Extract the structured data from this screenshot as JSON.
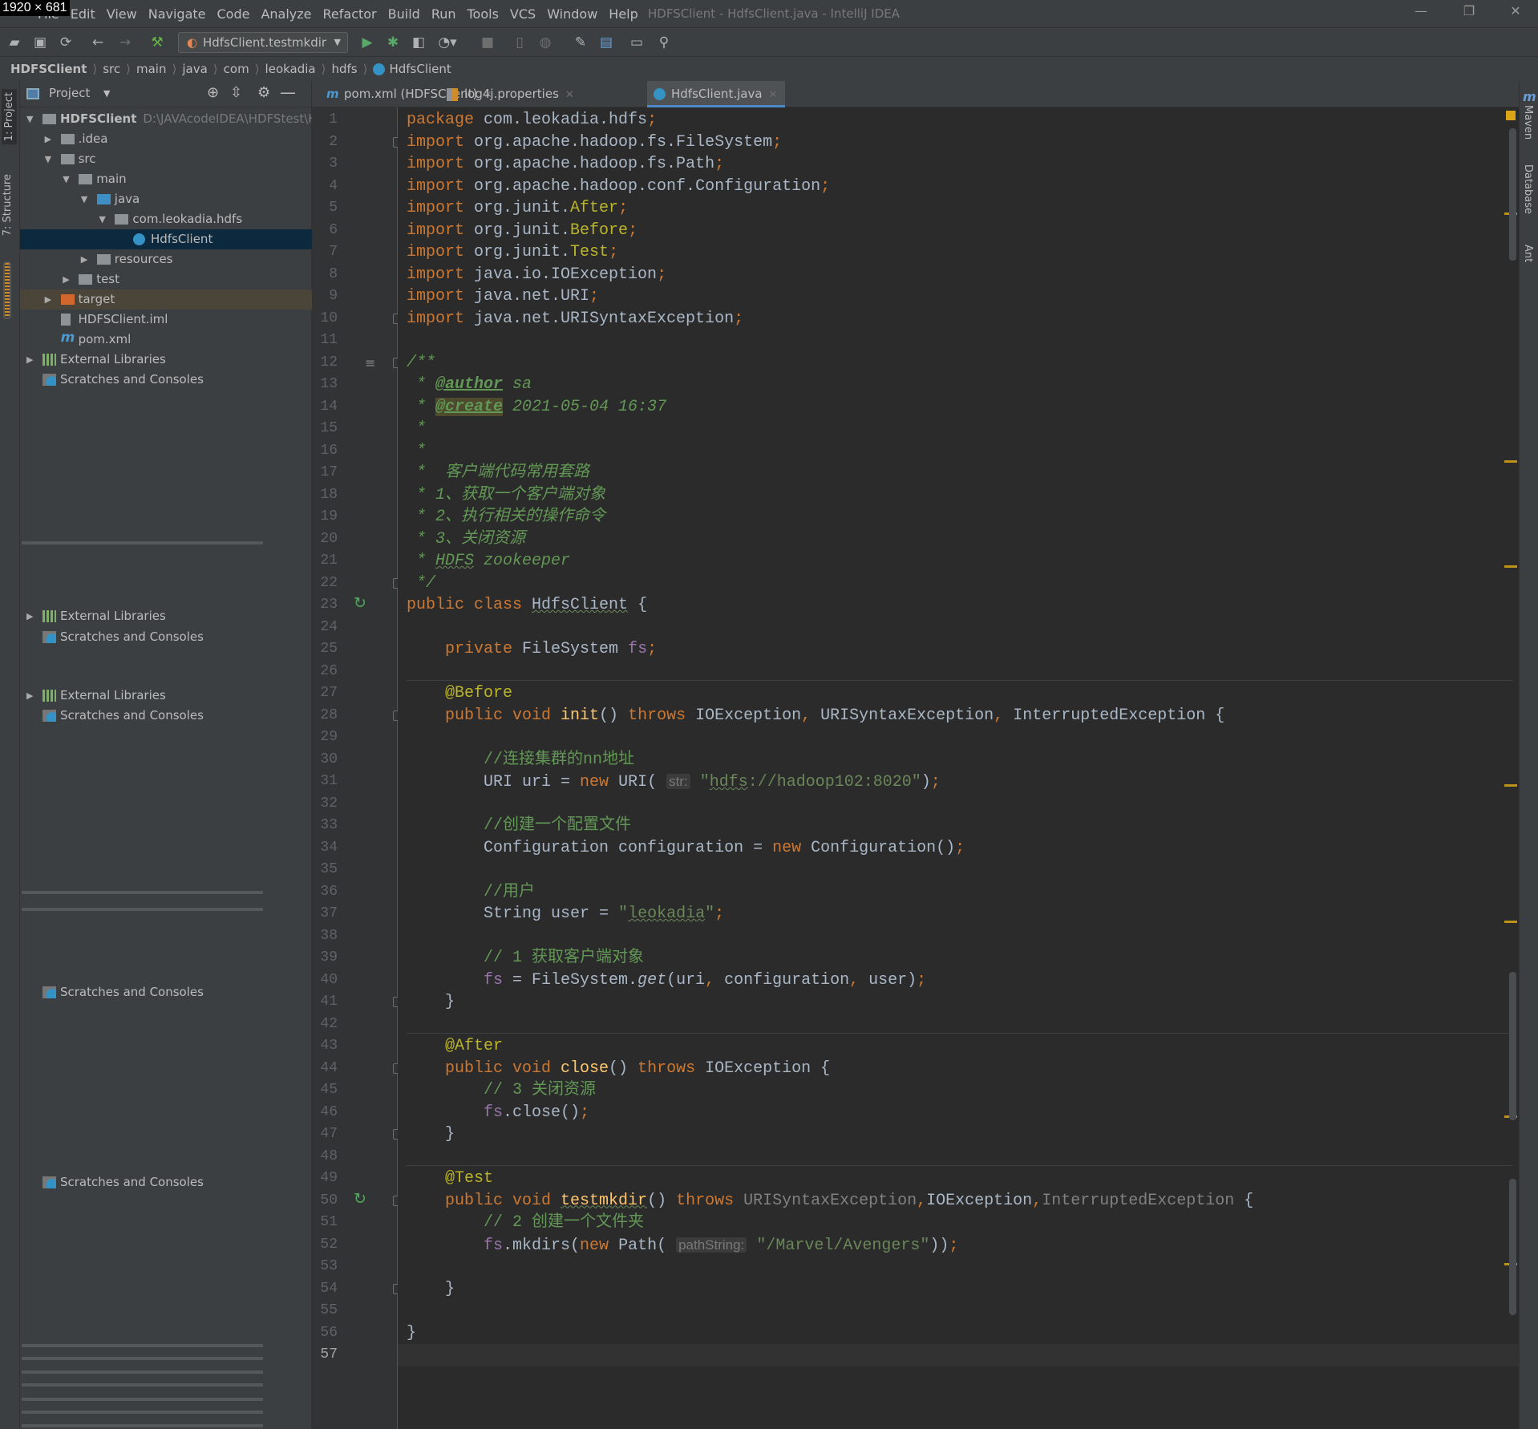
{
  "overlay_label": "1920 × 681",
  "window": {
    "title": "HDFSClient - HdfsClient.java - IntelliJ IDEA",
    "minimize": "—",
    "restore": "❐",
    "close": "✕"
  },
  "menu": [
    "File",
    "Edit",
    "View",
    "Navigate",
    "Code",
    "Analyze",
    "Refactor",
    "Build",
    "Run",
    "Tools",
    "VCS",
    "Window",
    "Help"
  ],
  "toolbar": {
    "run_config": "HdfsClient.testmkdir"
  },
  "breadcrumb": [
    "HDFSClient",
    "src",
    "main",
    "java",
    "com",
    "leokadia",
    "hdfs",
    "HdfsClient"
  ],
  "left_strip": {
    "project": "1: Project",
    "structure": "7: Structure"
  },
  "right_strip": {
    "maven": "Maven",
    "database": "Database",
    "ant": "Ant"
  },
  "project_panel": {
    "title": "Project",
    "tree": [
      {
        "level": 0,
        "state": "open",
        "icon": "module-folder-icon",
        "label": "HDFSClient",
        "hint": "D:\\JAVAcodeIDEA\\HDFStest\\HI",
        "bold": true
      },
      {
        "level": 1,
        "state": "closed",
        "icon": "folder-icon",
        "label": ".idea"
      },
      {
        "level": 1,
        "state": "open",
        "icon": "folder-icon",
        "label": "src"
      },
      {
        "level": 2,
        "state": "open",
        "icon": "folder-icon",
        "label": "main"
      },
      {
        "level": 3,
        "state": "open",
        "icon": "source-folder-icon",
        "label": "java"
      },
      {
        "level": 4,
        "state": "open",
        "icon": "package-icon",
        "label": "com.leokadia.hdfs"
      },
      {
        "level": 5,
        "state": "none",
        "icon": "java-class-icon",
        "label": "HdfsClient",
        "selected": true
      },
      {
        "level": 3,
        "state": "closed",
        "icon": "resources-folder-icon",
        "label": "resources"
      },
      {
        "level": 2,
        "state": "closed",
        "icon": "folder-icon",
        "label": "test"
      },
      {
        "level": 1,
        "state": "closed",
        "icon": "excluded-folder-icon",
        "label": "target",
        "highlight": true
      },
      {
        "level": 1,
        "state": "none",
        "icon": "iml-file-icon",
        "label": "HDFSClient.iml"
      },
      {
        "level": 1,
        "state": "none",
        "icon": "maven-icon",
        "label": "pom.xml"
      },
      {
        "level": 0,
        "state": "closed",
        "icon": "libraries-icon",
        "label": "External Libraries"
      },
      {
        "level": 0,
        "state": "none",
        "icon": "scratches-icon",
        "label": "Scratches and Consoles"
      }
    ],
    "ghost_rows": [
      {
        "label": "External Libraries",
        "arrow": true
      },
      {
        "label": "Scratches and Consoles"
      },
      {
        "label": "External Libraries",
        "arrow": true
      },
      {
        "label": "Scratches and Consoles"
      },
      {
        "label": "Scratches and Consoles"
      },
      {
        "label": "Scratches and Consoles"
      }
    ]
  },
  "tabs": [
    {
      "label": "pom.xml (HDFSClient)",
      "icon": "maven-icon",
      "active": false
    },
    {
      "label": "log4j.properties",
      "icon": "properties-file-icon",
      "active": false
    },
    {
      "label": "HdfsClient.java",
      "icon": "java-class-icon",
      "active": true
    }
  ],
  "editor": {
    "current_line": 57,
    "lines": [
      [
        [
          "package",
          "k"
        ],
        [
          " com.leokadia.hdfs",
          ""
        ],
        [
          ";",
          "k"
        ]
      ],
      [
        [
          "import",
          "k"
        ],
        [
          " org.apache.hadoop.fs.FileSystem",
          ""
        ],
        [
          ";",
          "k"
        ]
      ],
      [
        [
          "import",
          "k"
        ],
        [
          " org.apache.hadoop.fs.Path",
          ""
        ],
        [
          ";",
          "k"
        ]
      ],
      [
        [
          "import",
          "k"
        ],
        [
          " org.apache.hadoop.conf.Configuration",
          ""
        ],
        [
          ";",
          "k"
        ]
      ],
      [
        [
          "import",
          "k"
        ],
        [
          " org.junit.",
          ""
        ],
        [
          "After",
          "a"
        ],
        [
          ";",
          "k"
        ]
      ],
      [
        [
          "import",
          "k"
        ],
        [
          " org.junit.",
          ""
        ],
        [
          "Before",
          "a"
        ],
        [
          ";",
          "k"
        ]
      ],
      [
        [
          "import",
          "k"
        ],
        [
          " org.junit.",
          ""
        ],
        [
          "Test",
          "a"
        ],
        [
          ";",
          "k"
        ]
      ],
      [
        [
          "import",
          "k"
        ],
        [
          " java.io.IOException",
          ""
        ],
        [
          ";",
          "k"
        ]
      ],
      [
        [
          "import",
          "k"
        ],
        [
          " java.net.URI",
          ""
        ],
        [
          ";",
          "k"
        ]
      ],
      [
        [
          "import",
          "k"
        ],
        [
          " java.net.URISyntaxException",
          ""
        ],
        [
          ";",
          "k"
        ]
      ],
      [],
      [
        [
          "/**",
          "d"
        ]
      ],
      [
        [
          " * ",
          "d"
        ],
        [
          "@author",
          "dt"
        ],
        [
          " sa",
          "d"
        ]
      ],
      [
        [
          " * ",
          "d"
        ],
        [
          "@create",
          "dt dh"
        ],
        [
          " 2021-05-04 16:37",
          "d"
        ]
      ],
      [
        [
          " *",
          "d"
        ]
      ],
      [
        [
          " *",
          "d"
        ]
      ],
      [
        [
          " *  客户端代码常用套路",
          "d"
        ]
      ],
      [
        [
          " * 1、获取一个客户端对象",
          "d"
        ]
      ],
      [
        [
          " * 2、执行相关的操作命令",
          "d"
        ]
      ],
      [
        [
          " * 3、关闭资源",
          "d"
        ]
      ],
      [
        [
          " * ",
          "d"
        ],
        [
          "HDFS",
          "d u"
        ],
        [
          " zookeeper",
          "d"
        ]
      ],
      [
        [
          " */",
          "d"
        ]
      ],
      [
        [
          "public class ",
          "k"
        ],
        [
          "HdfsClient",
          "u"
        ],
        [
          " {",
          ""
        ]
      ],
      [],
      [
        [
          "    private ",
          "k"
        ],
        [
          "FileSystem ",
          ""
        ],
        [
          "fs",
          "f"
        ],
        [
          ";",
          "k"
        ]
      ],
      [],
      [
        [
          "    @Before",
          "a"
        ]
      ],
      [
        [
          "    public void ",
          "k"
        ],
        [
          "init",
          "m"
        ],
        [
          "() ",
          ""
        ],
        [
          "throws ",
          "k"
        ],
        [
          "IOException",
          ""
        ],
        [
          ", ",
          "k"
        ],
        [
          "URISyntaxException",
          ""
        ],
        [
          ", ",
          "k"
        ],
        [
          "InterruptedException {",
          ""
        ]
      ],
      [],
      [
        [
          "        //连接集群的nn地址",
          "c"
        ]
      ],
      [
        [
          "        URI uri = ",
          ""
        ],
        [
          "new ",
          "k"
        ],
        [
          "URI( ",
          ""
        ],
        [
          "str:",
          "h"
        ],
        [
          " ",
          ""
        ],
        [
          "\"",
          "s"
        ],
        [
          "hdfs",
          "s u"
        ],
        [
          "://hadoop102:8020\"",
          "s"
        ],
        [
          ")",
          ""
        ],
        [
          ";",
          "k"
        ]
      ],
      [],
      [
        [
          "        //创建一个配置文件",
          "c"
        ]
      ],
      [
        [
          "        Configuration configuration = ",
          ""
        ],
        [
          "new ",
          "k"
        ],
        [
          "Configuration()",
          ""
        ],
        [
          ";",
          "k"
        ]
      ],
      [],
      [
        [
          "        //用户",
          "c"
        ]
      ],
      [
        [
          "        String user = ",
          ""
        ],
        [
          "\"",
          "s"
        ],
        [
          "leokadia",
          "s u"
        ],
        [
          "\"",
          "s"
        ],
        [
          ";",
          "k"
        ]
      ],
      [],
      [
        [
          "        // 1 获取客户端对象",
          "c"
        ]
      ],
      [
        [
          "        ",
          ""
        ],
        [
          "fs",
          "f"
        ],
        [
          " = FileSystem.",
          ""
        ],
        [
          "get",
          "i"
        ],
        [
          "(uri",
          ""
        ],
        [
          ", ",
          "k"
        ],
        [
          "configuration",
          ""
        ],
        [
          ", ",
          "k"
        ],
        [
          "user)",
          ""
        ],
        [
          ";",
          "k"
        ]
      ],
      [
        [
          "    }",
          ""
        ]
      ],
      [],
      [
        [
          "    @After",
          "a"
        ]
      ],
      [
        [
          "    public void ",
          "k"
        ],
        [
          "close",
          "m"
        ],
        [
          "() ",
          ""
        ],
        [
          "throws ",
          "k"
        ],
        [
          "IOException {",
          ""
        ]
      ],
      [
        [
          "        // 3 关闭资源",
          "c"
        ]
      ],
      [
        [
          "        ",
          ""
        ],
        [
          "fs",
          "f"
        ],
        [
          ".close()",
          ""
        ],
        [
          ";",
          "k"
        ]
      ],
      [
        [
          "    }",
          ""
        ]
      ],
      [],
      [
        [
          "    @Test",
          "a"
        ]
      ],
      [
        [
          "    public void ",
          "k"
        ],
        [
          "testmkdir",
          "m u"
        ],
        [
          "() ",
          ""
        ],
        [
          "throws ",
          "k"
        ],
        [
          "URISyntaxException",
          "g"
        ],
        [
          ",",
          "k"
        ],
        [
          "IOException",
          ""
        ],
        [
          ",",
          "k"
        ],
        [
          "InterruptedException",
          "g"
        ],
        [
          " {",
          ""
        ]
      ],
      [
        [
          "        // 2 创建一个文件夹",
          "c"
        ]
      ],
      [
        [
          "        ",
          ""
        ],
        [
          "fs",
          "f"
        ],
        [
          ".mkdirs(",
          ""
        ],
        [
          "new ",
          "k"
        ],
        [
          "Path( ",
          ""
        ],
        [
          "pathString:",
          "h"
        ],
        [
          " ",
          ""
        ],
        [
          "\"/Marvel/Avengers\"",
          "s"
        ],
        [
          "))",
          ""
        ],
        [
          ";",
          "k"
        ]
      ],
      [],
      [
        [
          "    }",
          ""
        ]
      ],
      [],
      [
        [
          "}",
          ""
        ]
      ],
      []
    ],
    "run_gutter_lines": [
      23,
      50
    ],
    "fold_lines": [
      2,
      10,
      12,
      22,
      28,
      41,
      44,
      47,
      50,
      54
    ],
    "method_separators_before": [
      27,
      43,
      49
    ]
  },
  "colors": {
    "accent": "#4a88c7",
    "keyword": "#cc7832",
    "string": "#6a8759",
    "annotation": "#bbb529",
    "selection": "#0d293e"
  }
}
